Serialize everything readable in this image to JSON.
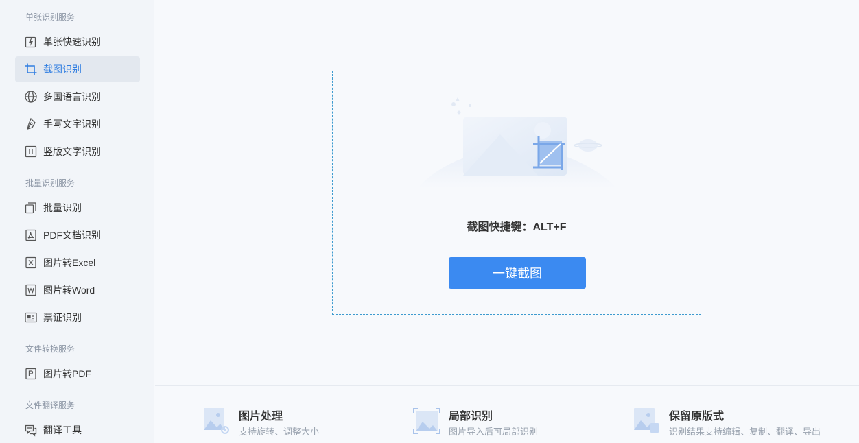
{
  "sidebar": {
    "sections": [
      {
        "title": "单张识别服务"
      },
      {
        "title": "批量识别服务"
      },
      {
        "title": "文件转换服务"
      },
      {
        "title": "文件翻译服务"
      }
    ],
    "items": [
      {
        "label": "单张快速识别",
        "icon": "quick-recognize-icon"
      },
      {
        "label": "截图识别",
        "icon": "crop-icon",
        "active": true
      },
      {
        "label": "多国语言识别",
        "icon": "globe-icon"
      },
      {
        "label": "手写文字识别",
        "icon": "pen-icon"
      },
      {
        "label": "竖版文字识别",
        "icon": "vertical-text-icon"
      },
      {
        "label": "批量识别",
        "icon": "batch-icon"
      },
      {
        "label": "PDF文档识别",
        "icon": "pdf-icon"
      },
      {
        "label": "图片转Excel",
        "icon": "excel-icon"
      },
      {
        "label": "图片转Word",
        "icon": "word-icon"
      },
      {
        "label": "票证识别",
        "icon": "id-card-icon"
      },
      {
        "label": "图片转PDF",
        "icon": "pdf-convert-icon"
      },
      {
        "label": "翻译工具",
        "icon": "translate-icon"
      }
    ]
  },
  "main": {
    "hotkey_text": "截图快捷键：ALT+F",
    "capture_button": "一键截图",
    "accent_color": "#3b8af1"
  },
  "features": [
    {
      "title": "图片处理",
      "desc": "支持旋转、调整大小"
    },
    {
      "title": "局部识别",
      "desc": "图片导入后可局部识别"
    },
    {
      "title": "保留原版式",
      "desc": "识别结果支持编辑、复制、翻译、导出"
    }
  ]
}
